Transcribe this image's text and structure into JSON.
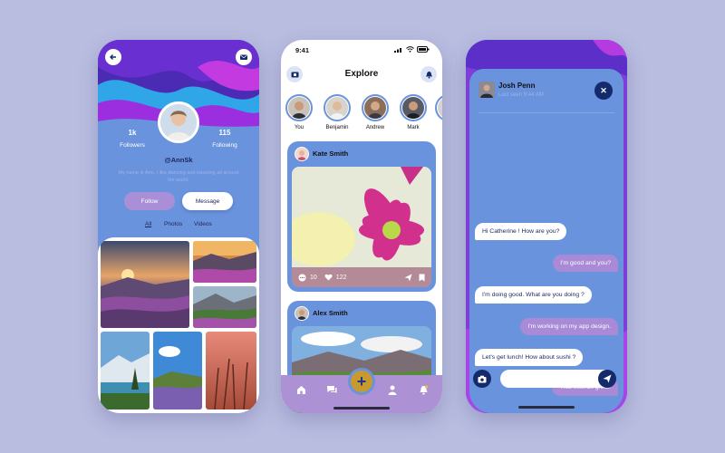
{
  "colors": {
    "background": "#b9bde0",
    "primary": "#6a93de",
    "accent_purple": "#a98ad6",
    "dark_navy": "#142a6b",
    "gold": "#c79a30"
  },
  "profile": {
    "followers_count": "1k",
    "followers_label": "Followers",
    "following_count": "115",
    "following_label": "Following",
    "handle": "@AnnSk",
    "bio": "My name is Ann. I like dancing and traveling all around the world.",
    "follow_label": "Follow",
    "message_label": "Message",
    "tabs": [
      "All",
      "Photos",
      "Videos"
    ],
    "icons": {
      "back": "arrow-left-icon",
      "mail": "envelope-icon"
    }
  },
  "explore": {
    "time": "9:41",
    "title": "Explore",
    "stories": [
      {
        "name": "You"
      },
      {
        "name": "Benjamin"
      },
      {
        "name": "Andrew"
      },
      {
        "name": "Mark"
      },
      {
        "name": ""
      }
    ],
    "posts": [
      {
        "author": "Kate Smith",
        "comments": "10",
        "likes": "122"
      },
      {
        "author": "Alex Smith"
      }
    ],
    "nav_icons": [
      "home-icon",
      "chat-icon",
      "add-icon",
      "profile-icon",
      "notification-icon"
    ]
  },
  "chat": {
    "contact_name": "Josh Penn",
    "last_seen": "Last seen 9:44 AM",
    "messages": [
      {
        "from": "them",
        "text": "Hi Catherine ! How are you?"
      },
      {
        "from": "me",
        "text": "I'm good and you?"
      },
      {
        "from": "them",
        "text": "I'm doing good. What are you doing ?"
      },
      {
        "from": "me",
        "text": "I'm working on my app design."
      },
      {
        "from": "them",
        "text": "Let's get lunch! How about sushi ?"
      },
      {
        "from": "me",
        "text": "That sounds great!"
      }
    ],
    "input_placeholder": ""
  }
}
